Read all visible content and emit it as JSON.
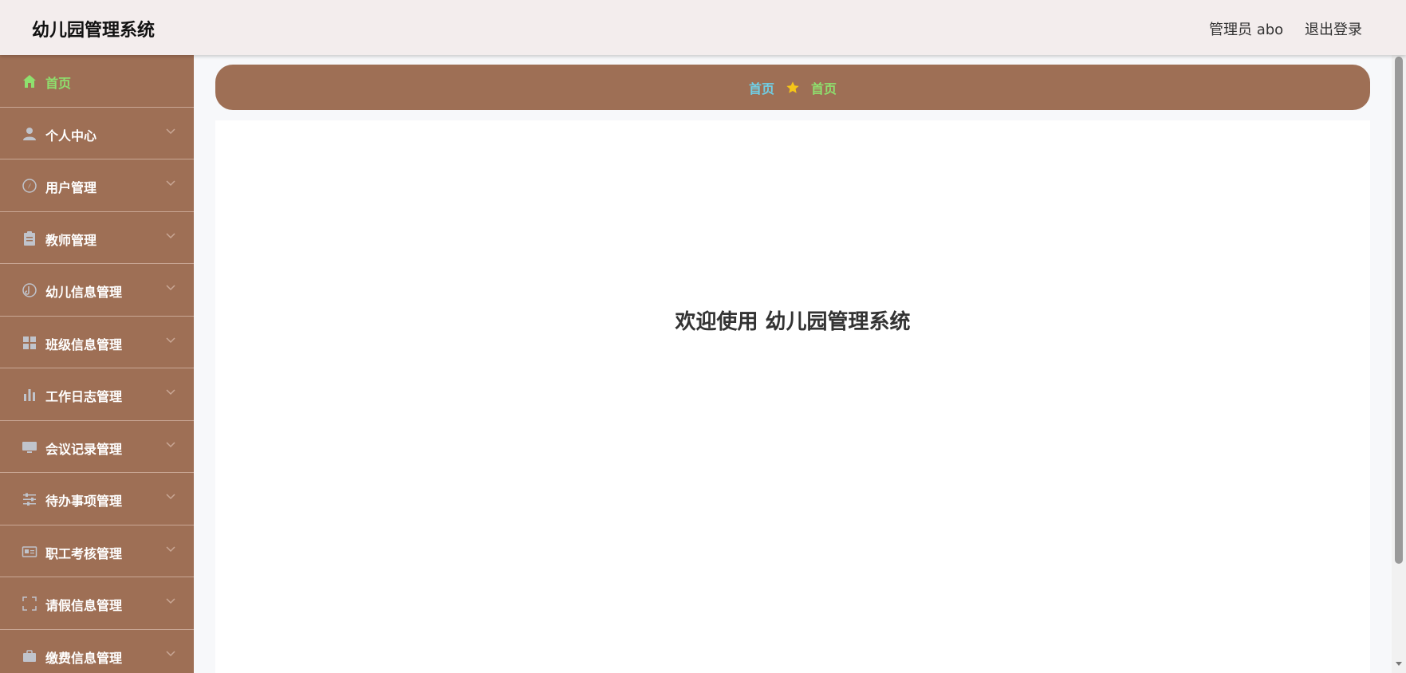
{
  "header": {
    "app_title": "幼儿园管理系统",
    "user_label": "管理员 abo",
    "logout_label": "退出登录"
  },
  "sidebar": {
    "items": [
      {
        "label": "首页",
        "icon": "home-icon",
        "active": true
      },
      {
        "label": "个人中心",
        "icon": "user-icon"
      },
      {
        "label": "用户管理",
        "icon": "compass-icon"
      },
      {
        "label": "教师管理",
        "icon": "clipboard-icon"
      },
      {
        "label": "幼儿信息管理",
        "icon": "music-disc-icon"
      },
      {
        "label": "班级信息管理",
        "icon": "grid-icon"
      },
      {
        "label": "工作日志管理",
        "icon": "bar-chart-icon"
      },
      {
        "label": "会议记录管理",
        "icon": "monitor-icon"
      },
      {
        "label": "待办事项管理",
        "icon": "sliders-icon"
      },
      {
        "label": "职工考核管理",
        "icon": "id-card-icon"
      },
      {
        "label": "请假信息管理",
        "icon": "fullscreen-icon"
      },
      {
        "label": "缴费信息管理",
        "icon": "briefcase-icon"
      }
    ]
  },
  "breadcrumb": {
    "home": "首页",
    "current": "首页",
    "separator_icon": "star-icon"
  },
  "main": {
    "welcome": "欢迎使用 幼儿园管理系统"
  },
  "colors": {
    "sidebar_bg": "#9e6f55",
    "active_text": "#8ee06e",
    "breadcrumb_home": "#6fd0e8",
    "star": "#f5c518"
  }
}
